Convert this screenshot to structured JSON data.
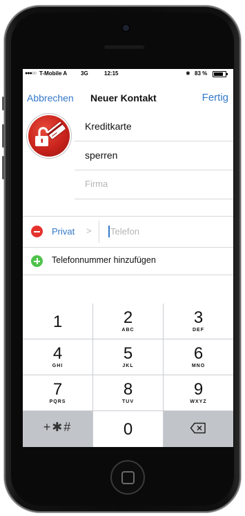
{
  "status_bar": {
    "signal_dots": "●●●○○",
    "carrier": "T-Mobile A",
    "network": "3G",
    "time": "12:15",
    "bluetooth": "✱",
    "battery_percent": "83 %",
    "battery_level": 0.83
  },
  "nav": {
    "cancel_label": "Abbrechen",
    "title": "Neuer Kontakt",
    "done_label": "Fertig"
  },
  "contact": {
    "avatar_icon": "unlocked-padlock-card-icon",
    "first_name": "Kreditkarte",
    "last_name": "sperren",
    "company_placeholder": "Firma"
  },
  "phone_entry": {
    "label": "Privat",
    "chevron": ">",
    "placeholder": "Telefon"
  },
  "add_phone_label": "Telefonnummer hinzufügen",
  "keypad": {
    "keys": [
      {
        "digit": "1",
        "letters": ""
      },
      {
        "digit": "2",
        "letters": "ABC"
      },
      {
        "digit": "3",
        "letters": "DEF"
      },
      {
        "digit": "4",
        "letters": "GHI"
      },
      {
        "digit": "5",
        "letters": "JKL"
      },
      {
        "digit": "6",
        "letters": "MNO"
      },
      {
        "digit": "7",
        "letters": "PQRS"
      },
      {
        "digit": "8",
        "letters": "TUV"
      },
      {
        "digit": "9",
        "letters": "WXYZ"
      },
      {
        "symbols": "+✱#"
      },
      {
        "digit": "0",
        "letters": ""
      },
      {
        "icon": "backspace-icon"
      }
    ]
  },
  "colors": {
    "accent": "#3478c9",
    "delete_red": "#e5322d",
    "add_green": "#4fc24b",
    "avatar_red": "#c8231c"
  }
}
